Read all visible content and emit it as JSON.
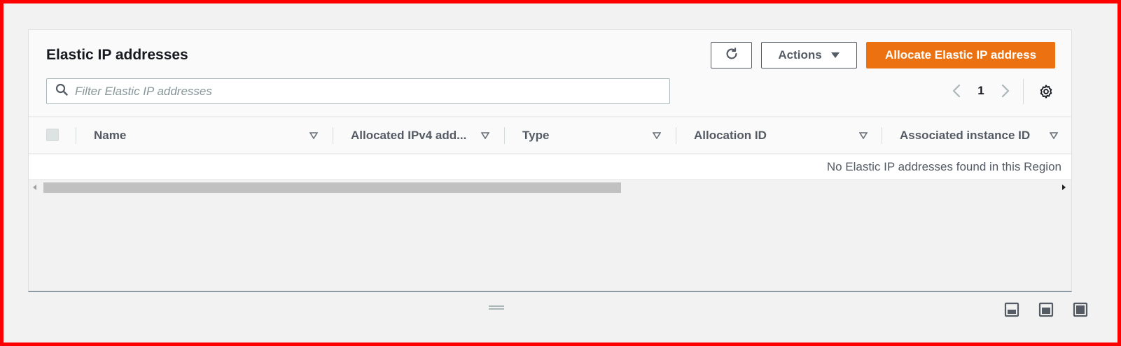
{
  "panel": {
    "title": "Elastic IP addresses",
    "refresh_icon": "refresh-icon",
    "actions_label": "Actions",
    "actions_icon": "caret-down-icon",
    "primary_label": "Allocate Elastic IP address",
    "primary_color": "#ec7211"
  },
  "search": {
    "placeholder": "Filter Elastic IP addresses",
    "value": "",
    "icon": "search-icon"
  },
  "pagination": {
    "current_page": "1",
    "prev_icon": "chevron-left-icon",
    "next_icon": "chevron-right-icon",
    "settings_icon": "gear-icon"
  },
  "table": {
    "columns": [
      {
        "label": "Name"
      },
      {
        "label": "Allocated IPv4 add..."
      },
      {
        "label": "Type"
      },
      {
        "label": "Allocation ID"
      },
      {
        "label": "Associated instance ID"
      }
    ],
    "empty_message": "No Elastic IP addresses found in this Region"
  },
  "footer": {
    "icons": [
      "split-bottom-icon",
      "split-side-icon",
      "fullscreen-icon"
    ]
  }
}
